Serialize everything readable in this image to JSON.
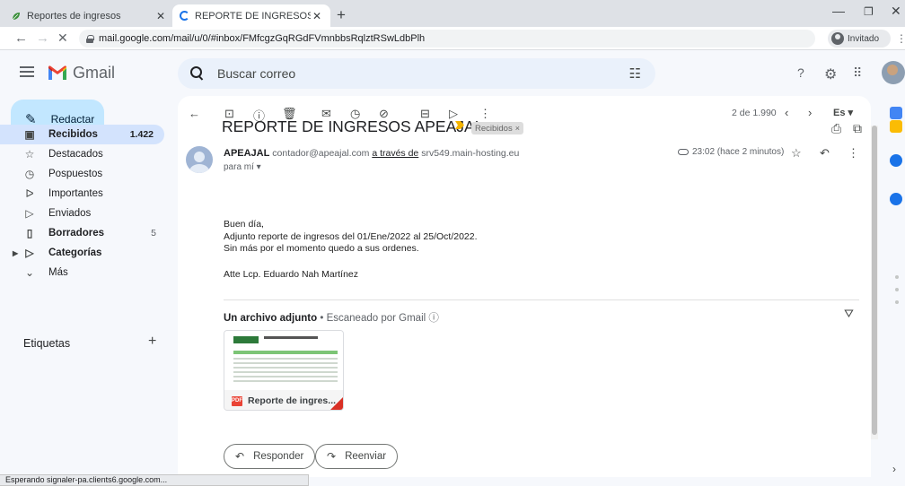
{
  "browser": {
    "tabs": [
      {
        "title": "Reportes de ingresos",
        "active": false
      },
      {
        "title": "REPORTE DE INGRESOS APEAJAL",
        "active": true
      }
    ],
    "url": "mail.google.com/mail/u/0/#inbox/FMfcgzGqRGdFVmnbbsRqlztRSwLdbPlh",
    "profile_label": "Invitado",
    "status_text": "Esperando signaler-pa.clients6.google.com..."
  },
  "gmail": {
    "logo_text": "Gmail",
    "search_placeholder": "Buscar correo",
    "compose_label": "Redactar",
    "nav": [
      {
        "label": "Recibidos",
        "icon": "inbox-icon",
        "count": "1.422",
        "selected": true
      },
      {
        "label": "Destacados",
        "icon": "star-icon",
        "count": ""
      },
      {
        "label": "Pospuestos",
        "icon": "clock-icon",
        "count": ""
      },
      {
        "label": "Importantes",
        "icon": "important-icon",
        "count": ""
      },
      {
        "label": "Enviados",
        "icon": "send-icon",
        "count": ""
      },
      {
        "label": "Borradores",
        "icon": "draft-icon",
        "count": "5",
        "bold": true
      },
      {
        "label": "Categorías",
        "icon": "label-icon",
        "count": "",
        "bold": true
      },
      {
        "label": "Más",
        "icon": "chevron-down-icon",
        "count": ""
      }
    ],
    "labels_header": "Etiquetas"
  },
  "message": {
    "pager": "2 de 1.990",
    "language": "Es",
    "subject": "REPORTE DE INGRESOS APEAJAL",
    "label_chip": "Recibidos",
    "sender_name": "APEAJAL",
    "sender_email": "contador@apeajal.com",
    "via_text": "a través de",
    "via_host": "srv549.main-hosting.eu",
    "to_text": "para mí",
    "time": "23:02 (hace 2 minutos)",
    "body_lines": [
      "Buen día,",
      "Adjunto reporte de ingresos del 01/Ene/2022 al 25/Oct/2022.",
      "Sin más por el momento quedo a sus ordenes."
    ],
    "signature": "Atte Lcp. Eduardo Nah Martínez",
    "attachments_title": "Un archivo adjunto",
    "attachments_scan": "Escaneado por Gmail",
    "attachment_name": "Reporte de ingres...",
    "attachment_badge": "PDF",
    "reply_label": "Responder",
    "forward_label": "Reenviar"
  },
  "colors": {
    "compose_bg": "#c2e7ff",
    "selected_nav_bg": "#d3e3fd",
    "search_bg": "#eaf1fb",
    "accent_blue": "#1a73e8",
    "pdf_red": "#ea4335"
  }
}
